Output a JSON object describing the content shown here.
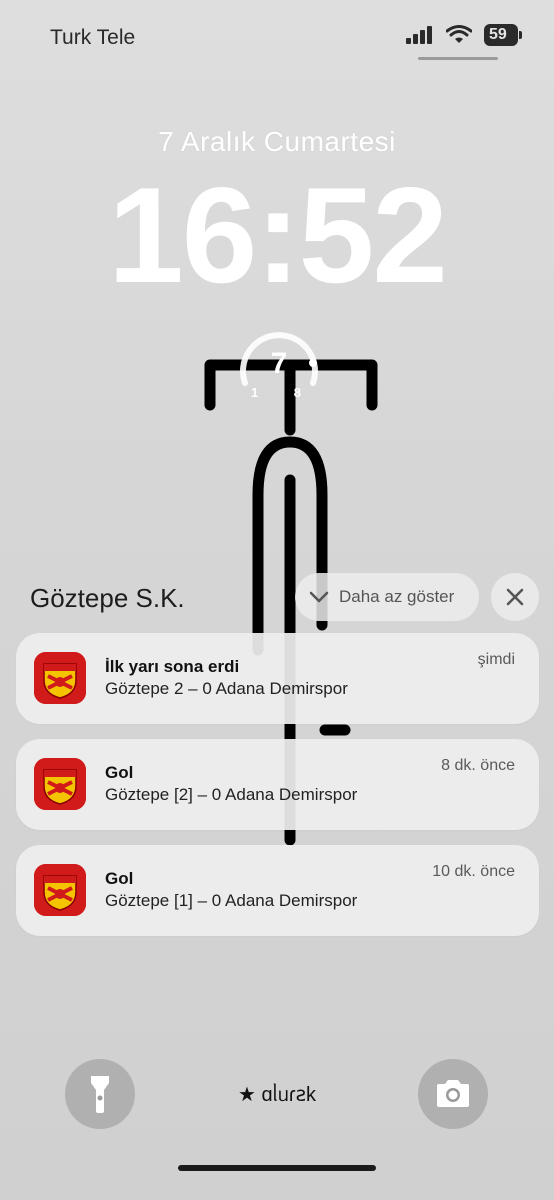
{
  "status_bar": {
    "carrier": "Turk Tele",
    "battery": "59"
  },
  "lock_screen": {
    "date": "7 Aralık Cumartesi",
    "time": "16:52",
    "caption": "★ ɑᥣᥙɾꙅk"
  },
  "widget": {
    "value": "7",
    "min": "1",
    "max": "8"
  },
  "notification_group": {
    "app_name": "Göztepe S.K.",
    "show_less_label": "Daha az göster",
    "notifications": [
      {
        "title": "İlk yarı sona erdi",
        "body": "Göztepe 2 – 0 Adana Demirspor",
        "time": "şimdi"
      },
      {
        "title": "Gol",
        "body": "Göztepe [2] – 0 Adana Demirspor",
        "time": "8 dk. önce"
      },
      {
        "title": "Gol",
        "body": "Göztepe [1] – 0 Adana Demirspor",
        "time": "10 dk. önce"
      }
    ]
  },
  "icons": {
    "flashlight": "flashlight-icon",
    "camera": "camera-icon",
    "close": "close-icon",
    "chevron": "chevron-down-icon"
  },
  "colors": {
    "brand_red": "#d11a1a",
    "brand_yellow": "#f5c400"
  }
}
